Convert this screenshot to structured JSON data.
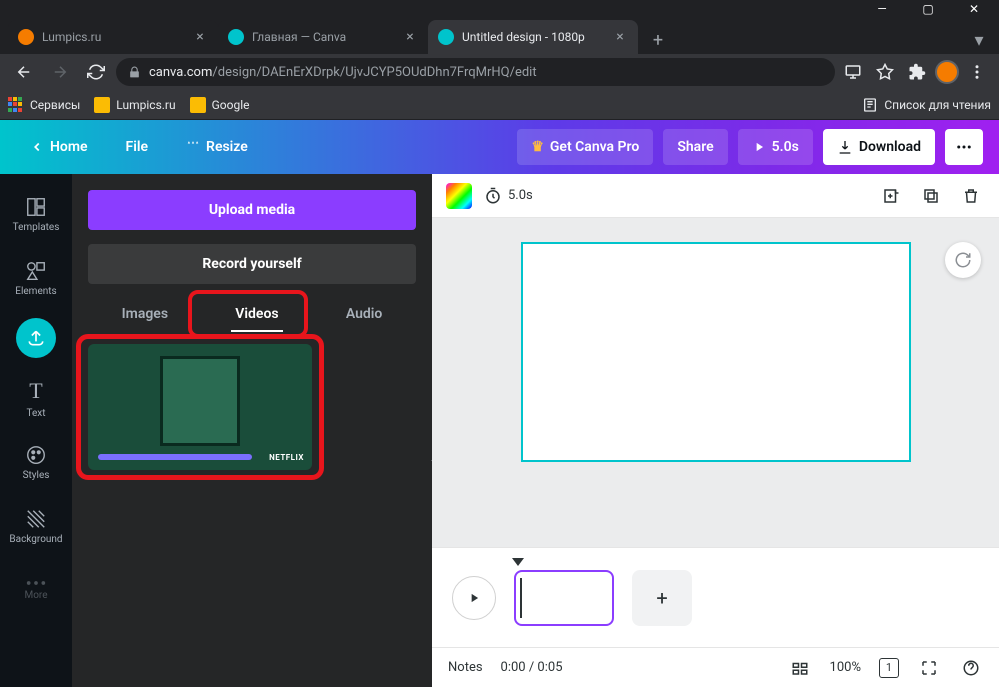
{
  "window": {
    "minimize": "—",
    "maximize": "▢",
    "close": "✕"
  },
  "tabs": [
    {
      "title": "Lumpics.ru",
      "favicon_color": "#f57c00",
      "active": false
    },
    {
      "title": "Главная — Canva",
      "favicon_color": "#00c4cc",
      "active": false
    },
    {
      "title": "Untitled design - 1080p",
      "favicon_color": "#00c4cc",
      "active": true
    }
  ],
  "address": {
    "domain": "canva.com",
    "path": "/design/DAEnErXDrpk/UjvJCYP5OUdDhn7FrqMrHQ/edit"
  },
  "bookmarks": [
    {
      "label": "Сервисы"
    },
    {
      "label": "Lumpics.ru"
    },
    {
      "label": "Google"
    }
  ],
  "reading_list_label": "Список для чтения",
  "canva_header": {
    "home": "Home",
    "file": "File",
    "resize": "Resize",
    "get_pro": "Get Canva Pro",
    "share": "Share",
    "duration": "5.0s",
    "download": "Download"
  },
  "rail": {
    "templates": "Templates",
    "elements": "Elements",
    "text": "Text",
    "styles": "Styles",
    "background": "Background",
    "more": "More"
  },
  "panel": {
    "upload_media": "Upload media",
    "record_yourself": "Record yourself",
    "tabs": {
      "images": "Images",
      "videos": "Videos",
      "audio": "Audio"
    },
    "thumb_label": "NETFLIX"
  },
  "canvas_toolbar": {
    "duration": "5.0s"
  },
  "bottombar": {
    "notes": "Notes",
    "time": "0:00 / 0:05",
    "zoom": "100%",
    "page_indicator": "1"
  }
}
